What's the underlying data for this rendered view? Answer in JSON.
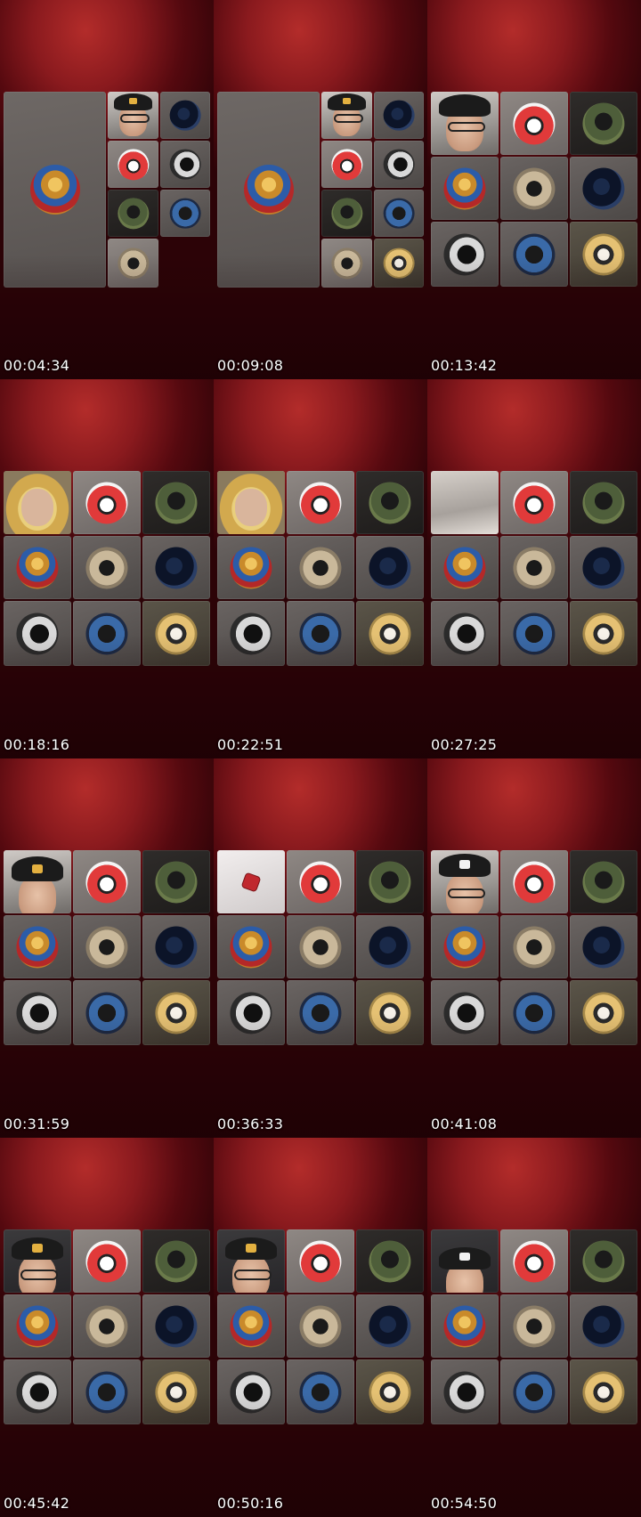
{
  "frames": [
    {
      "id": 1,
      "timestamp": "00:04:34"
    },
    {
      "id": 2,
      "timestamp": "00:09:08"
    },
    {
      "id": 3,
      "timestamp": "00:13:42"
    },
    {
      "id": 4,
      "timestamp": "00:18:16"
    },
    {
      "id": 5,
      "timestamp": "00:22:51"
    },
    {
      "id": 6,
      "timestamp": "00:27:25"
    },
    {
      "id": 7,
      "timestamp": "00:31:59"
    },
    {
      "id": 8,
      "timestamp": "00:36:33"
    },
    {
      "id": 9,
      "timestamp": "00:41:08"
    },
    {
      "id": 10,
      "timestamp": "00:45:42"
    },
    {
      "id": 11,
      "timestamp": "00:50:16"
    },
    {
      "id": 12,
      "timestamp": "00:54:50"
    }
  ],
  "participants": [
    {
      "name": "",
      "avatar": "jesus-portrait"
    },
    {
      "name": "",
      "avatar": "santa-mask"
    },
    {
      "name": "",
      "avatar": "moss-silhouette"
    },
    {
      "name": "",
      "avatar": "night-sky"
    },
    {
      "name": "",
      "avatar": "bw-portrait"
    },
    {
      "name": "",
      "avatar": "gym-mirror"
    },
    {
      "name": "",
      "avatar": "blue-girl"
    },
    {
      "name": "",
      "avatar": "sunhat-woman"
    }
  ]
}
